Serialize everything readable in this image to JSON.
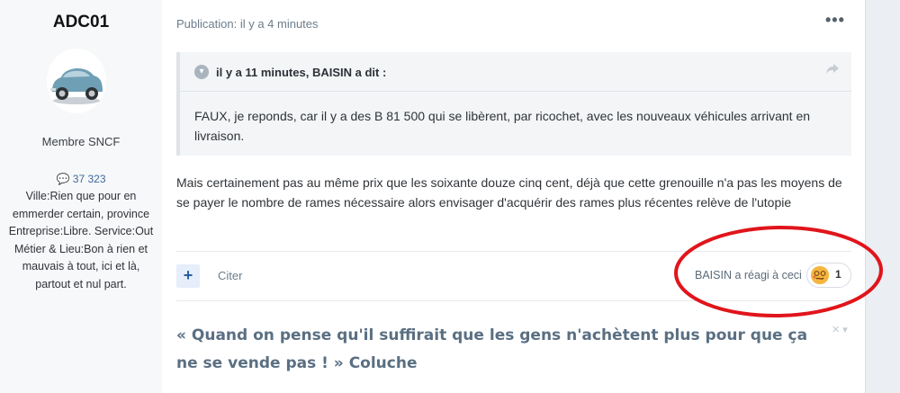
{
  "author": {
    "name": "ADC01",
    "group": "Membre SNCF",
    "post_count": "37 323",
    "fields": "Ville:Rien que pour en emmerder certain, province Entreprise:Libre. Service:Out Métier & Lieu:Bon à rien et mauvais à tout, ici et là, partout et nul part."
  },
  "post": {
    "published": "Publication: il y a 4 minutes",
    "more_label": "•••",
    "quote": {
      "citation": "il y a 11 minutes, BAISIN a dit :",
      "text": "FAUX, je reponds, car il y a des B 81 500 qui se libèrent, par ricochet, avec les nouveaux véhicules arrivant en livraison."
    },
    "body": "Mais certainement pas au même prix que les soixante douze cinq cent, déjà que cette grenouille n'a pas les moyens de se payer le nombre de rames nécessaire alors envisager d'acquérir des rames plus récentes relève de l'utopie",
    "actions": {
      "plus_label": "+",
      "quote_label": "Citer"
    },
    "reaction": {
      "text": "BAISIN a réagi à ceci",
      "count": "1",
      "emoji": "confused-face-icon"
    },
    "signature": "« Quand on pense qu'il suffirait que les gens n'achètent plus pour que ça ne se vende pas ! » Coluche"
  },
  "colors": {
    "annotation": "#e0151b",
    "accent": "#295f9e"
  }
}
